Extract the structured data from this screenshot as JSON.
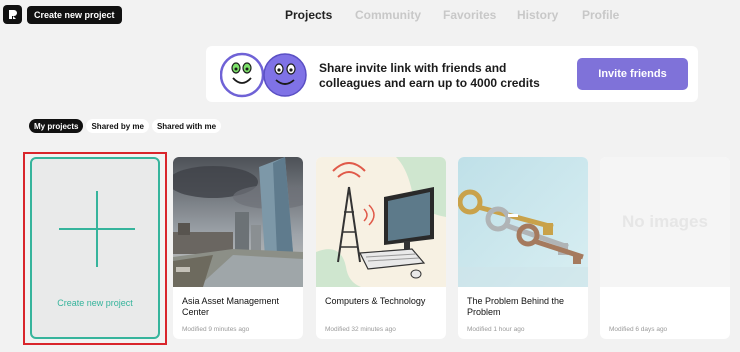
{
  "header": {
    "create_label": "Create new project",
    "nav": [
      {
        "label": "Projects",
        "active": true
      },
      {
        "label": "Community",
        "active": false
      },
      {
        "label": "Favorites",
        "active": false
      },
      {
        "label": "History",
        "active": false
      },
      {
        "label": "Profile",
        "active": false
      }
    ]
  },
  "banner": {
    "line1": "Share invite link with friends and",
    "line2": "colleagues and earn up to 4000 credits",
    "button": "Invite friends"
  },
  "filters": [
    "My projects",
    "Shared by me",
    "Shared with me"
  ],
  "create_card": {
    "label": "Create new project"
  },
  "projects": [
    {
      "title": "Asia Asset Management Center",
      "modified": "Modified 9 minutes ago",
      "image": "city-skyline-photo"
    },
    {
      "title": "Computers & Technology",
      "modified": "Modified 32 minutes ago",
      "image": "computer-tower-illustration"
    },
    {
      "title": "The Problem Behind the Problem",
      "modified": "Modified 1 hour ago",
      "image": "keys-photo"
    },
    {
      "title": "",
      "modified": "Modified 6 days ago",
      "image_placeholder": "No images"
    }
  ],
  "colors": {
    "accent": "#36b49c",
    "invite": "#7f72d9",
    "highlight": "#d9252b"
  }
}
